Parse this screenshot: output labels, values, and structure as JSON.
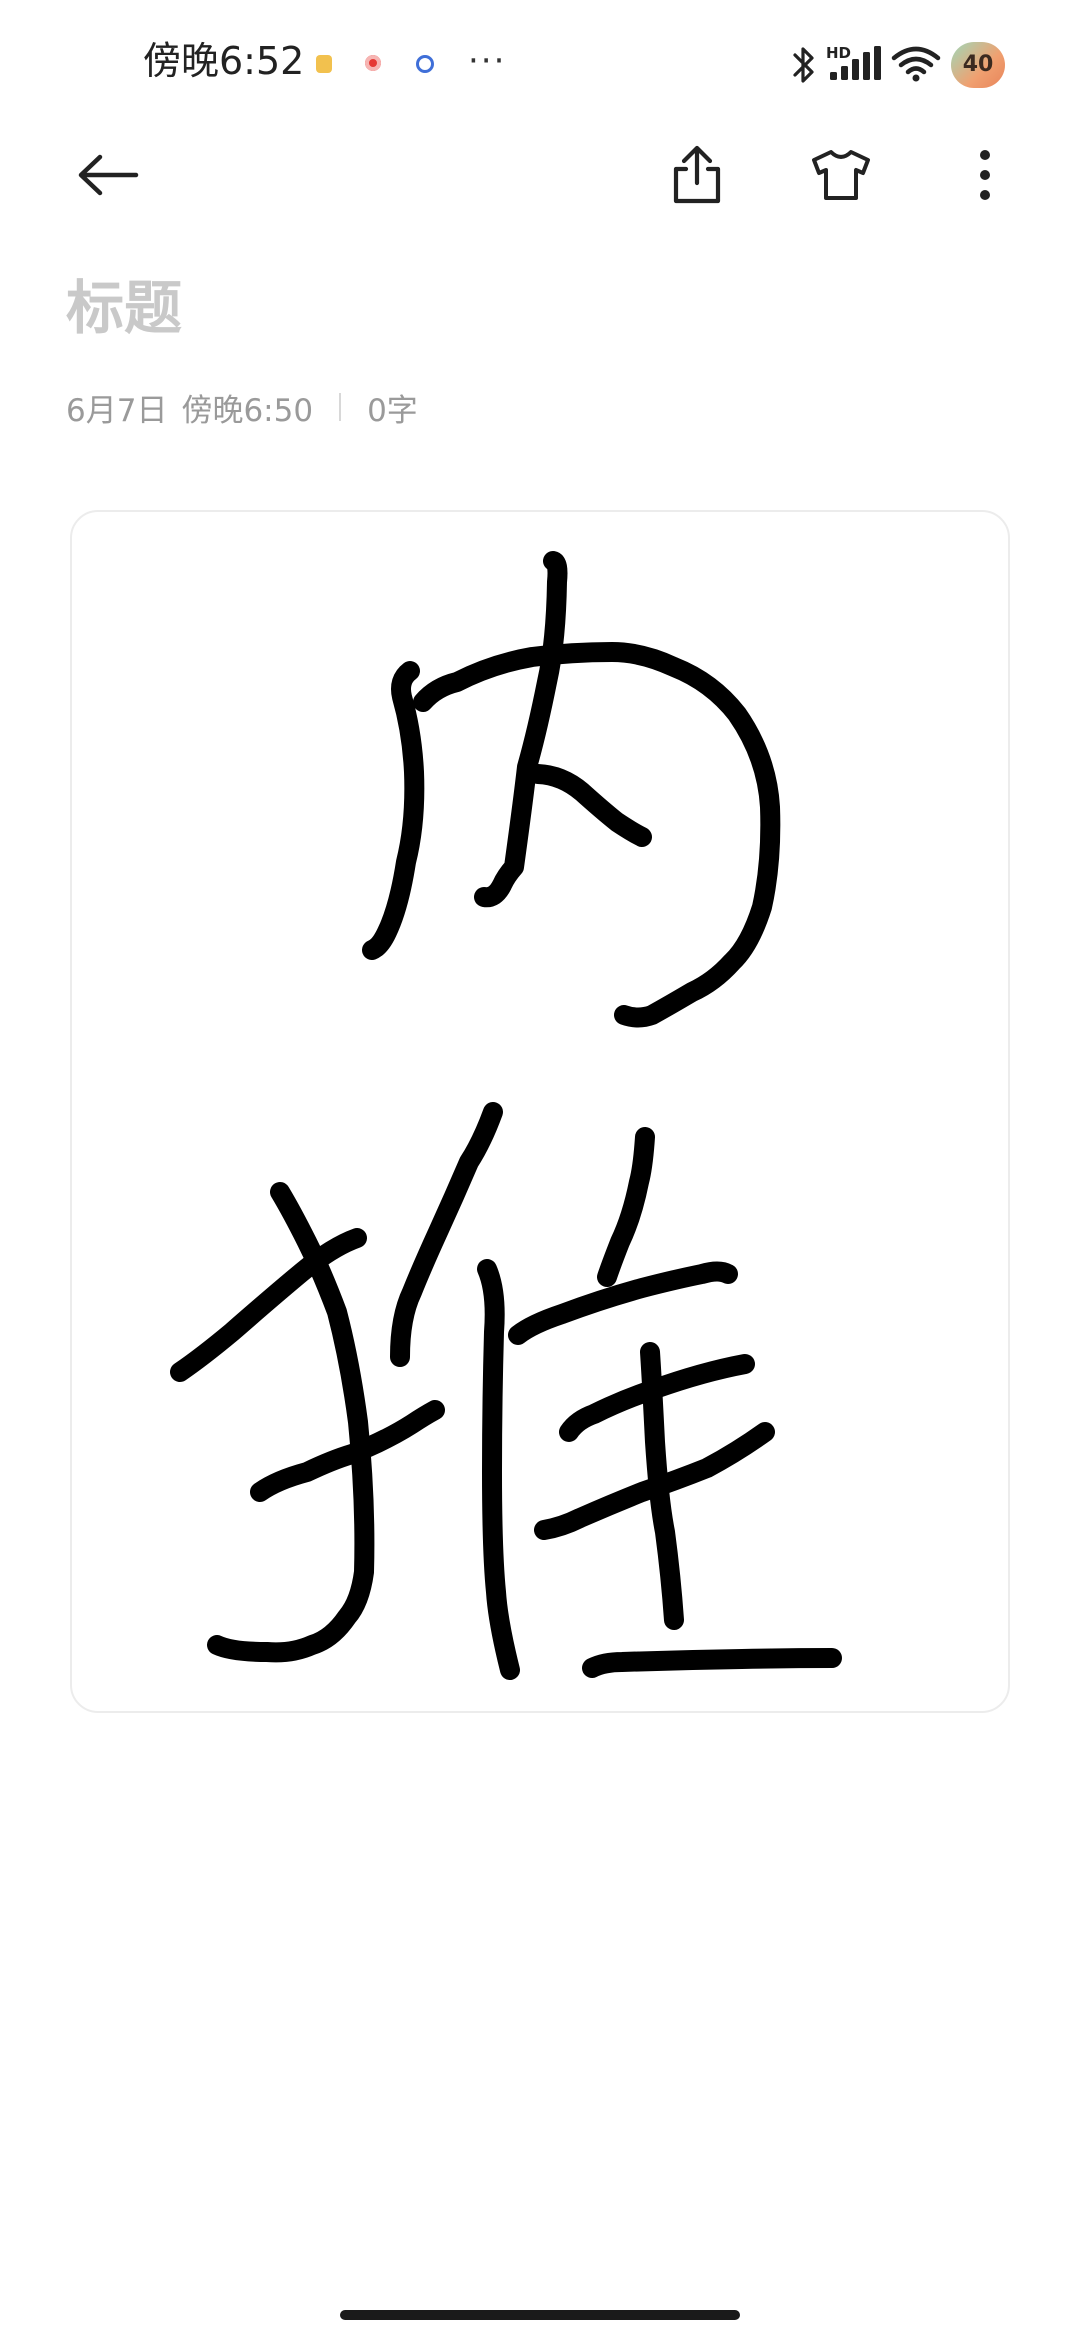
{
  "status_bar": {
    "time": "傍晚6:52",
    "more_indicator": "···",
    "battery_level": "40",
    "network_badge": "HD",
    "colors": {
      "notif_1": "#f2c14e",
      "notif_2": "#e53935",
      "notif_3": "#3f6fd8"
    }
  },
  "toolbar": {
    "back_icon": "arrow-left-icon",
    "share_icon": "share-icon",
    "theme_icon": "tshirt-icon",
    "more_icon": "more-vertical-icon"
  },
  "note": {
    "title_placeholder": "标题",
    "date": "6月7日",
    "time": "傍晚6:50",
    "word_count": "0字"
  },
  "drawing": {
    "description_icon": "handwriting-sketch",
    "stroke_color": "#000000"
  }
}
